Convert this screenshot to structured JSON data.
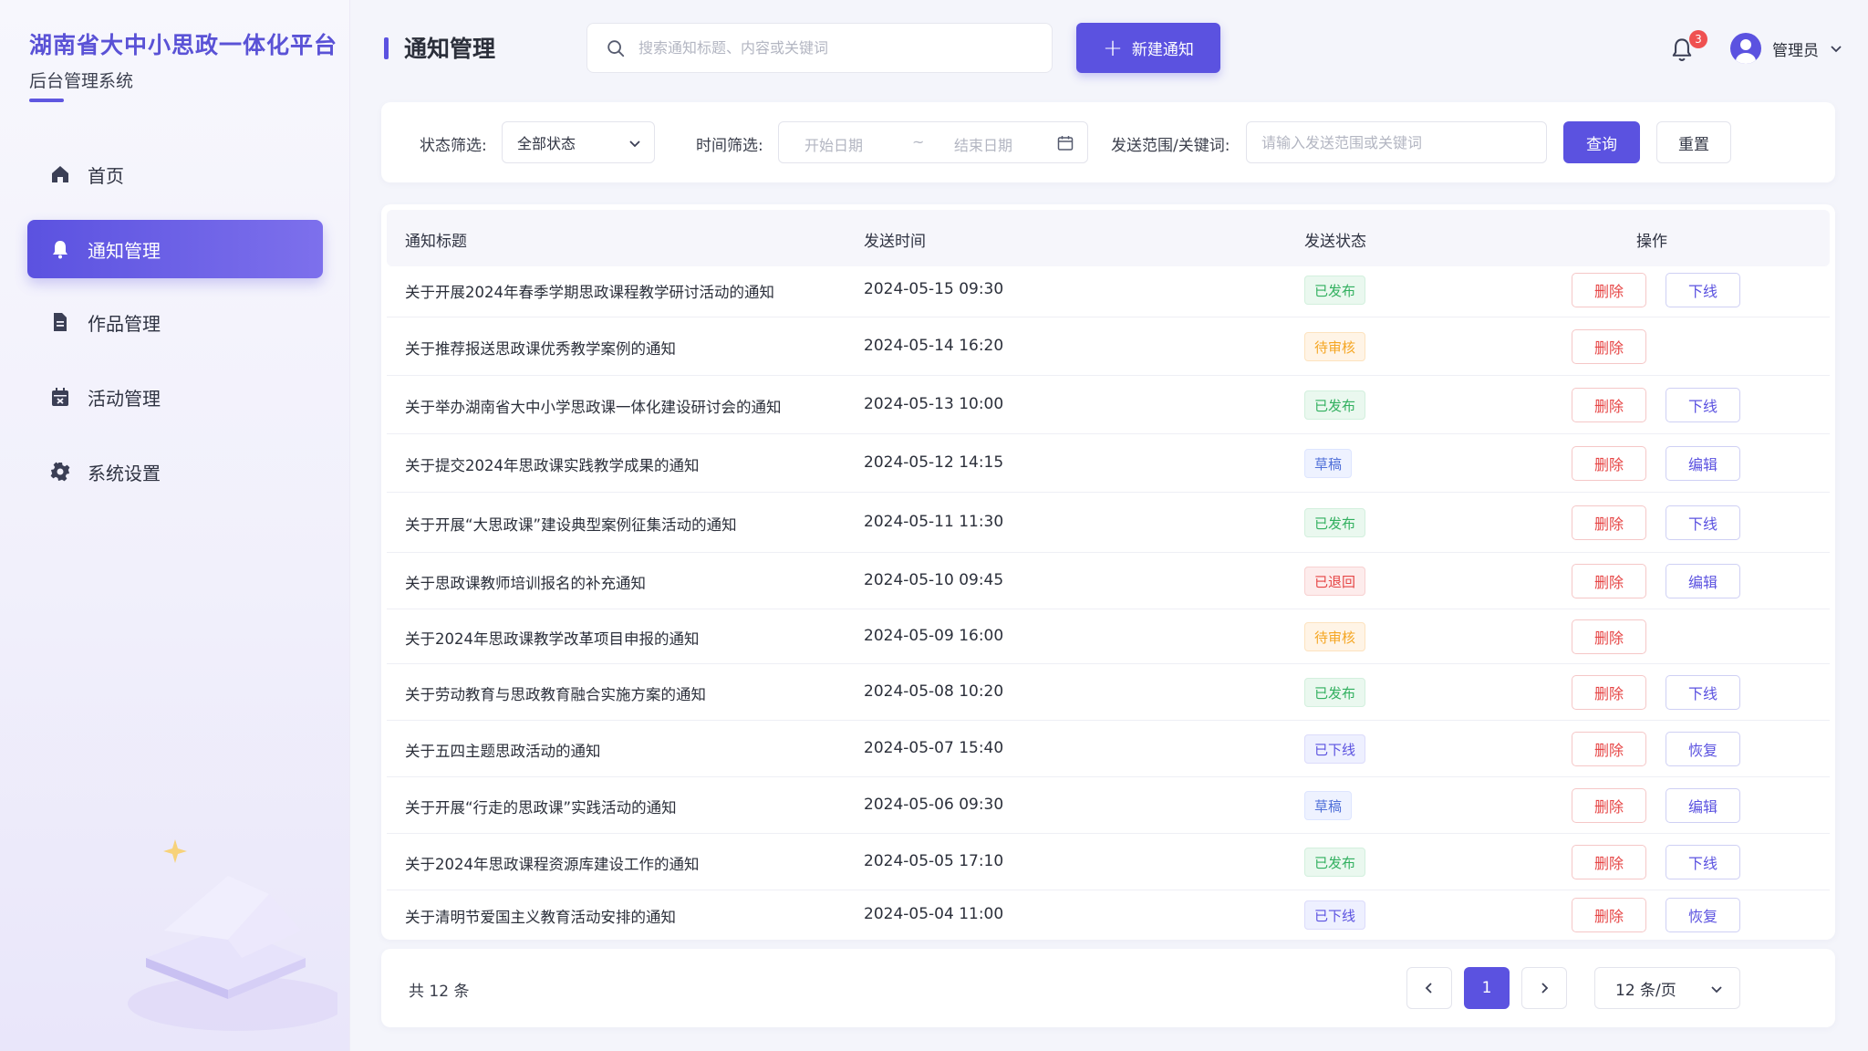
{
  "brand": {
    "title": "湖南省大中小思政一体化平台",
    "subtitle": "后台管理系统"
  },
  "sidebar": {
    "items": [
      {
        "label": "首页",
        "icon": "home-icon",
        "active": false
      },
      {
        "label": "通知管理",
        "icon": "bell-icon",
        "active": true
      },
      {
        "label": "作品管理",
        "icon": "document-icon",
        "active": false
      },
      {
        "label": "活动管理",
        "icon": "calendar-icon",
        "active": false
      },
      {
        "label": "系统设置",
        "icon": "gear-icon",
        "active": false
      }
    ]
  },
  "header": {
    "title": "通知管理",
    "search_placeholder": "搜索通知标题、内容或关键词",
    "new_button": "新建通知",
    "notification_count": "3",
    "user_name": "管理员"
  },
  "filters": {
    "status_label": "状态筛选:",
    "status_value": "全部状态",
    "time_label": "时间筛选:",
    "start_placeholder": "开始日期",
    "range_sep": "~",
    "end_placeholder": "结束日期",
    "keyword_label": "发送范围/关键词:",
    "keyword_placeholder": "请输入发送范围或关键词",
    "query_button": "查询",
    "reset_button": "重置"
  },
  "table": {
    "columns": [
      "通知标题",
      "发送时间",
      "发送状态",
      "操作"
    ],
    "rows": [
      {
        "title": "关于开展2024年春季学期思政课程教学研讨活动的通知",
        "time": "2024-05-15 09:30",
        "status": "已发布",
        "status_type": "published",
        "delete": "删除",
        "action": "下线"
      },
      {
        "title": "关于推荐报送思政课优秀教学案例的通知",
        "time": "2024-05-14 16:20",
        "status": "待审核",
        "status_type": "pending",
        "delete": "删除",
        "action": ""
      },
      {
        "title": "关于举办湖南省大中小学思政课一体化建设研讨会的通知",
        "time": "2024-05-13 10:00",
        "status": "已发布",
        "status_type": "published",
        "delete": "删除",
        "action": "下线"
      },
      {
        "title": "关于提交2024年思政课实践教学成果的通知",
        "time": "2024-05-12 14:15",
        "status": "草稿",
        "status_type": "draft",
        "delete": "删除",
        "action": "编辑"
      },
      {
        "title": "关于开展“大思政课”建设典型案例征集活动的通知",
        "time": "2024-05-11 11:30",
        "status": "已发布",
        "status_type": "published",
        "delete": "删除",
        "action": "下线"
      },
      {
        "title": "关于思政课教师培训报名的补充通知",
        "time": "2024-05-10 09:45",
        "status": "已退回",
        "status_type": "returned",
        "delete": "删除",
        "action": "编辑"
      },
      {
        "title": "关于2024年思政课教学改革项目申报的通知",
        "time": "2024-05-09 16:00",
        "status": "待审核",
        "status_type": "pending",
        "delete": "删除",
        "action": ""
      },
      {
        "title": "关于劳动教育与思政教育融合实施方案的通知",
        "time": "2024-05-08 10:20",
        "status": "已发布",
        "status_type": "published",
        "delete": "删除",
        "action": "下线"
      },
      {
        "title": "关于五四主题思政活动的通知",
        "time": "2024-05-07 15:40",
        "status": "已下线",
        "status_type": "offline",
        "delete": "删除",
        "action": "恢复"
      },
      {
        "title": "关于开展“行走的思政课”实践活动的通知",
        "time": "2024-05-06 09:30",
        "status": "草稿",
        "status_type": "draft",
        "delete": "删除",
        "action": "编辑"
      },
      {
        "title": "关于2024年思政课程资源库建设工作的通知",
        "time": "2024-05-05 17:10",
        "status": "已发布",
        "status_type": "published",
        "delete": "删除",
        "action": "下线"
      },
      {
        "title": "关于清明节爱国主义教育活动安排的通知",
        "time": "2024-05-04 11:00",
        "status": "已下线",
        "status_type": "offline",
        "delete": "删除",
        "action": "恢复"
      }
    ]
  },
  "pagination": {
    "total_text": "共 12 条",
    "current_page": "1",
    "page_size": "12 条/页"
  },
  "colors": {
    "accent": "#5b52e0",
    "published": "#32b05f",
    "pending": "#f5a623",
    "draft": "#4f6fd8",
    "returned": "#e64545",
    "offline": "#5b52e0"
  }
}
